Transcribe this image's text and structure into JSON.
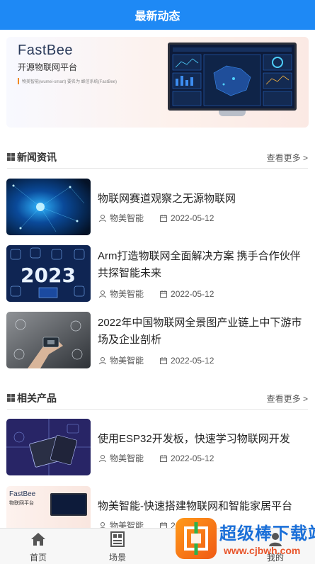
{
  "header": {
    "title": "最新动态"
  },
  "banner": {
    "brand": "FastBee",
    "subtitle": "开源物联网平台",
    "tiny_text": "物美智能(wumei-smart) 要名为 蜂信系统(FastBee)"
  },
  "sections": [
    {
      "title": "新闻资讯",
      "more_label": "查看更多 >"
    },
    {
      "title": "相关产品",
      "more_label": "查看更多 >"
    }
  ],
  "news": [
    {
      "title": "物联网赛道观察之无源物联网",
      "author": "物美智能",
      "date": "2022-05-12"
    },
    {
      "title": "Arm打造物联网全面解决方案 携手合作伙伴共探智能未来",
      "author": "物美智能",
      "date": "2022-05-12"
    },
    {
      "title": "2022年中国物联网全景图产业链上中下游市场及企业剖析",
      "author": "物美智能",
      "date": "2022-05-12"
    }
  ],
  "products": [
    {
      "title": "使用ESP32开发板，快速学习物联网开发",
      "author": "物美智能",
      "date": "2022-05-12"
    },
    {
      "title": "物美智能-快速搭建物联网和智能家居平台",
      "author": "物美智能",
      "date": "2022-05-12"
    }
  ],
  "thumb_text": {
    "year": "2023",
    "fastbee": "FastBee",
    "fastbee_sub": "物联网平台"
  },
  "tabs": [
    {
      "label": "首页",
      "icon": "home-icon"
    },
    {
      "label": "场景",
      "icon": "scene-icon"
    },
    {
      "label": "我的",
      "icon": "user-icon"
    }
  ],
  "watermark": {
    "text": "超级棒下载站",
    "url": "www.cjbwh.com"
  },
  "colors": {
    "accent": "#1e89f5",
    "watermark_blue": "#1a6fd8",
    "watermark_orange": "#e8542a"
  }
}
